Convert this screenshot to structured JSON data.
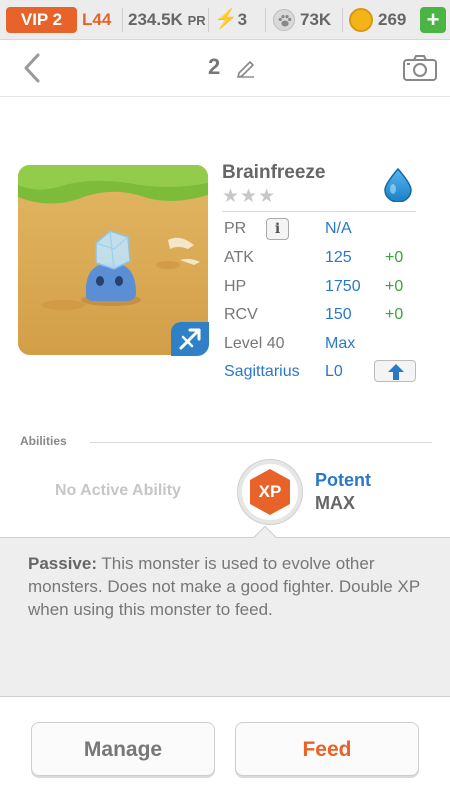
{
  "status_bar": {
    "vip": "VIP 2",
    "level": "L44",
    "power_rating": "234.5K",
    "power_rating_unit": "PR",
    "energy": "3",
    "paw_points": "73K",
    "coins": "269",
    "add_label": "+"
  },
  "nav": {
    "back_icon": "chevron-left-icon",
    "title_number": "2",
    "edit_icon": "pencil-icon",
    "camera_icon": "camera-icon"
  },
  "monster": {
    "name": "Brainfreeze",
    "stars": "★★★",
    "element_icon": "water-drop-icon",
    "sign_icon": "sagittarius-arrow-icon",
    "stats": [
      {
        "label": "PR",
        "value": "N/A",
        "bonus": ""
      },
      {
        "label": "ATK",
        "value": "125",
        "bonus": "+0"
      },
      {
        "label": "HP",
        "value": "1750",
        "bonus": "+0"
      },
      {
        "label": "RCV",
        "value": "150",
        "bonus": "+0"
      },
      {
        "label": "Level 40",
        "value": "Max",
        "bonus": ""
      }
    ],
    "info_label": "i",
    "sign": {
      "label": "Sagittarius",
      "level": "L0"
    },
    "upgrade_icon": "arrow-up-icon"
  },
  "abilities": {
    "header": "Abilities",
    "active": "No Active Ability",
    "passive_badge": "XP",
    "passive_name": "Potent",
    "passive_level": "MAX",
    "passive_title": "Passive:",
    "passive_description": " This monster is used to evolve other monsters. Does not make a good fighter. Double XP when using this monster to feed."
  },
  "actions": {
    "manage": "Manage",
    "feed": "Feed"
  },
  "colors": {
    "accent_orange": "#e8632a",
    "link_blue": "#2b78c9",
    "bonus_green": "#3aa33a",
    "add_green": "#4bb543"
  }
}
